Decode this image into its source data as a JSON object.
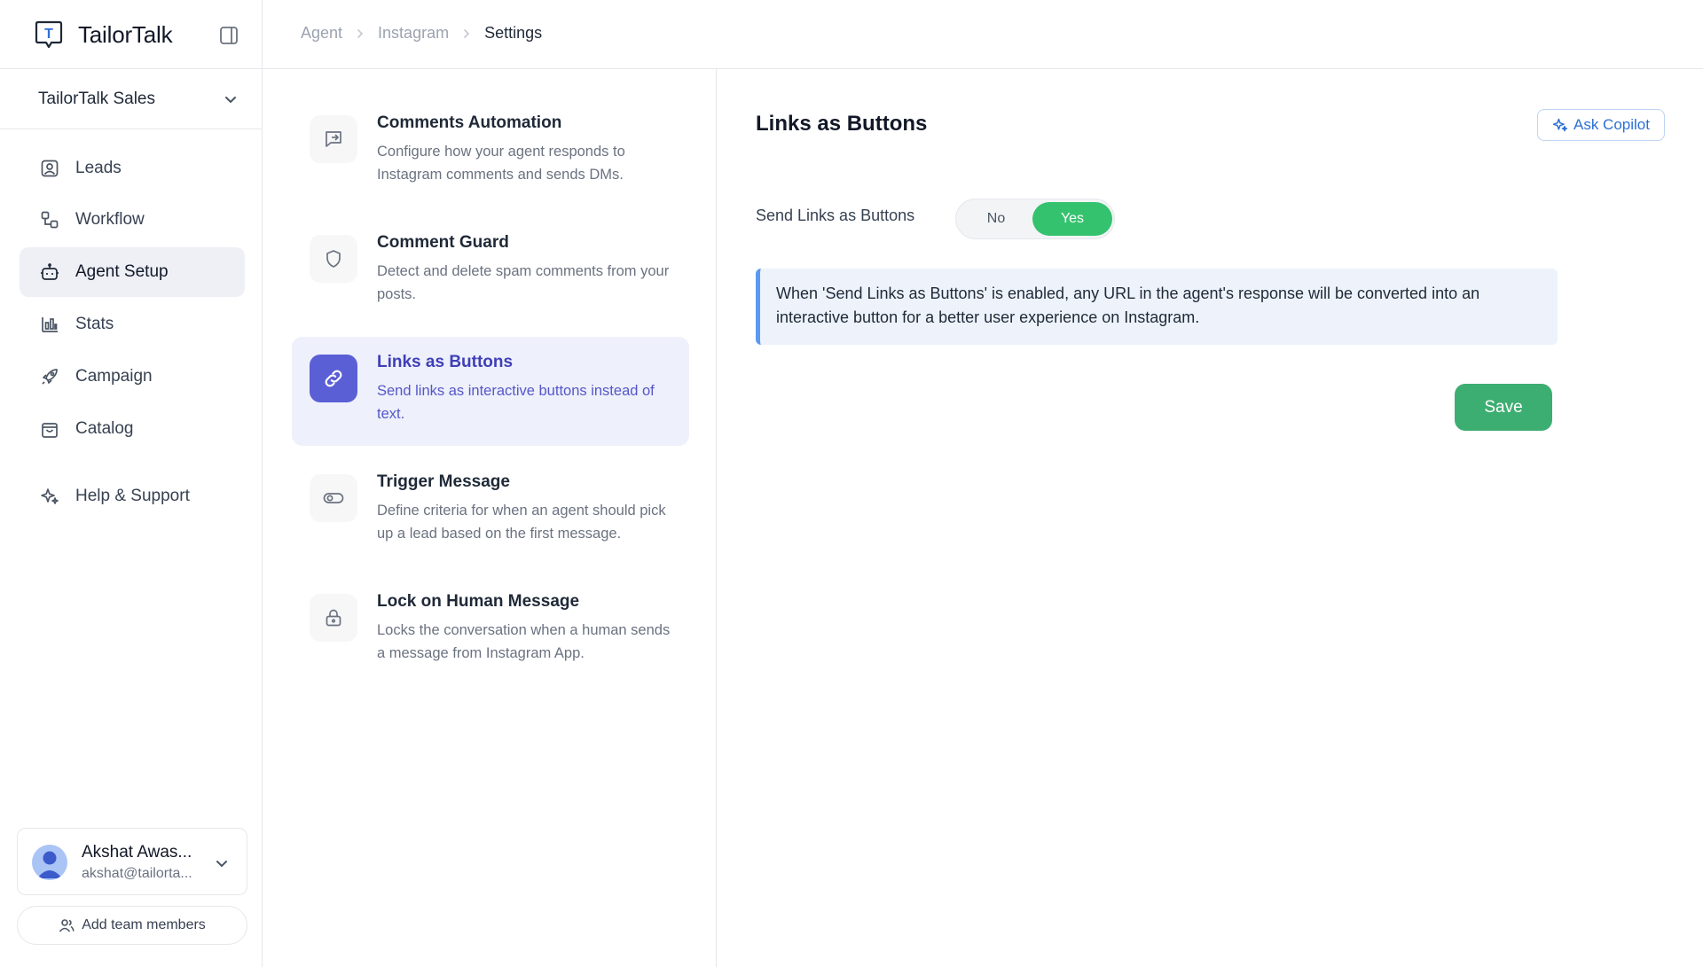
{
  "brand": {
    "name": "TailorTalk",
    "logo_letter": "T"
  },
  "workspace": {
    "name": "TailorTalk Sales"
  },
  "nav": {
    "items": [
      {
        "label": "Leads",
        "icon": "user-square-icon"
      },
      {
        "label": "Workflow",
        "icon": "workflow-icon"
      },
      {
        "label": "Agent Setup",
        "icon": "bot-icon",
        "active": true
      },
      {
        "label": "Stats",
        "icon": "bar-chart-icon"
      },
      {
        "label": "Campaign",
        "icon": "rocket-icon"
      },
      {
        "label": "Catalog",
        "icon": "shopping-bag-icon"
      },
      {
        "label": "Help & Support",
        "icon": "sparkle-icon"
      }
    ]
  },
  "profile": {
    "name": "Akshat Awas...",
    "email": "akshat@tailorta..."
  },
  "add_team": {
    "label": "Add team members"
  },
  "breadcrumb": {
    "items": [
      "Agent",
      "Instagram",
      "Settings"
    ]
  },
  "settings": {
    "items": [
      {
        "title": "Comments Automation",
        "description": "Configure how your agent responds to Instagram comments and sends DMs.",
        "icon": "message-reply-icon"
      },
      {
        "title": "Comment Guard",
        "description": "Detect and delete spam comments from your posts.",
        "icon": "shield-icon"
      },
      {
        "title": "Links as Buttons",
        "description": "Send links as interactive buttons instead of text.",
        "icon": "link-icon",
        "active": true
      },
      {
        "title": "Trigger Message",
        "description": "Define criteria for when an agent should pick up a lead based on the first message.",
        "icon": "toggle-icon"
      },
      {
        "title": "Lock on Human Message",
        "description": "Locks the conversation when a human sends a message from Instagram App.",
        "icon": "lock-icon"
      }
    ]
  },
  "detail": {
    "title": "Links as Buttons",
    "ask_copilot_label": "Ask Copilot",
    "field_label": "Send Links as Buttons",
    "toggle": {
      "no_label": "No",
      "yes_label": "Yes",
      "selected": "Yes"
    },
    "info_text": "When 'Send Links as Buttons' is enabled, any URL in the agent's response will be converted into an interactive button for a better user experience on Instagram.",
    "save_label": "Save"
  },
  "colors": {
    "accent": "#5b5fd6",
    "toggle_active": "#35c26e",
    "save": "#3dae71",
    "info_border": "#5a9af0",
    "copilot": "#2b6fd6"
  }
}
